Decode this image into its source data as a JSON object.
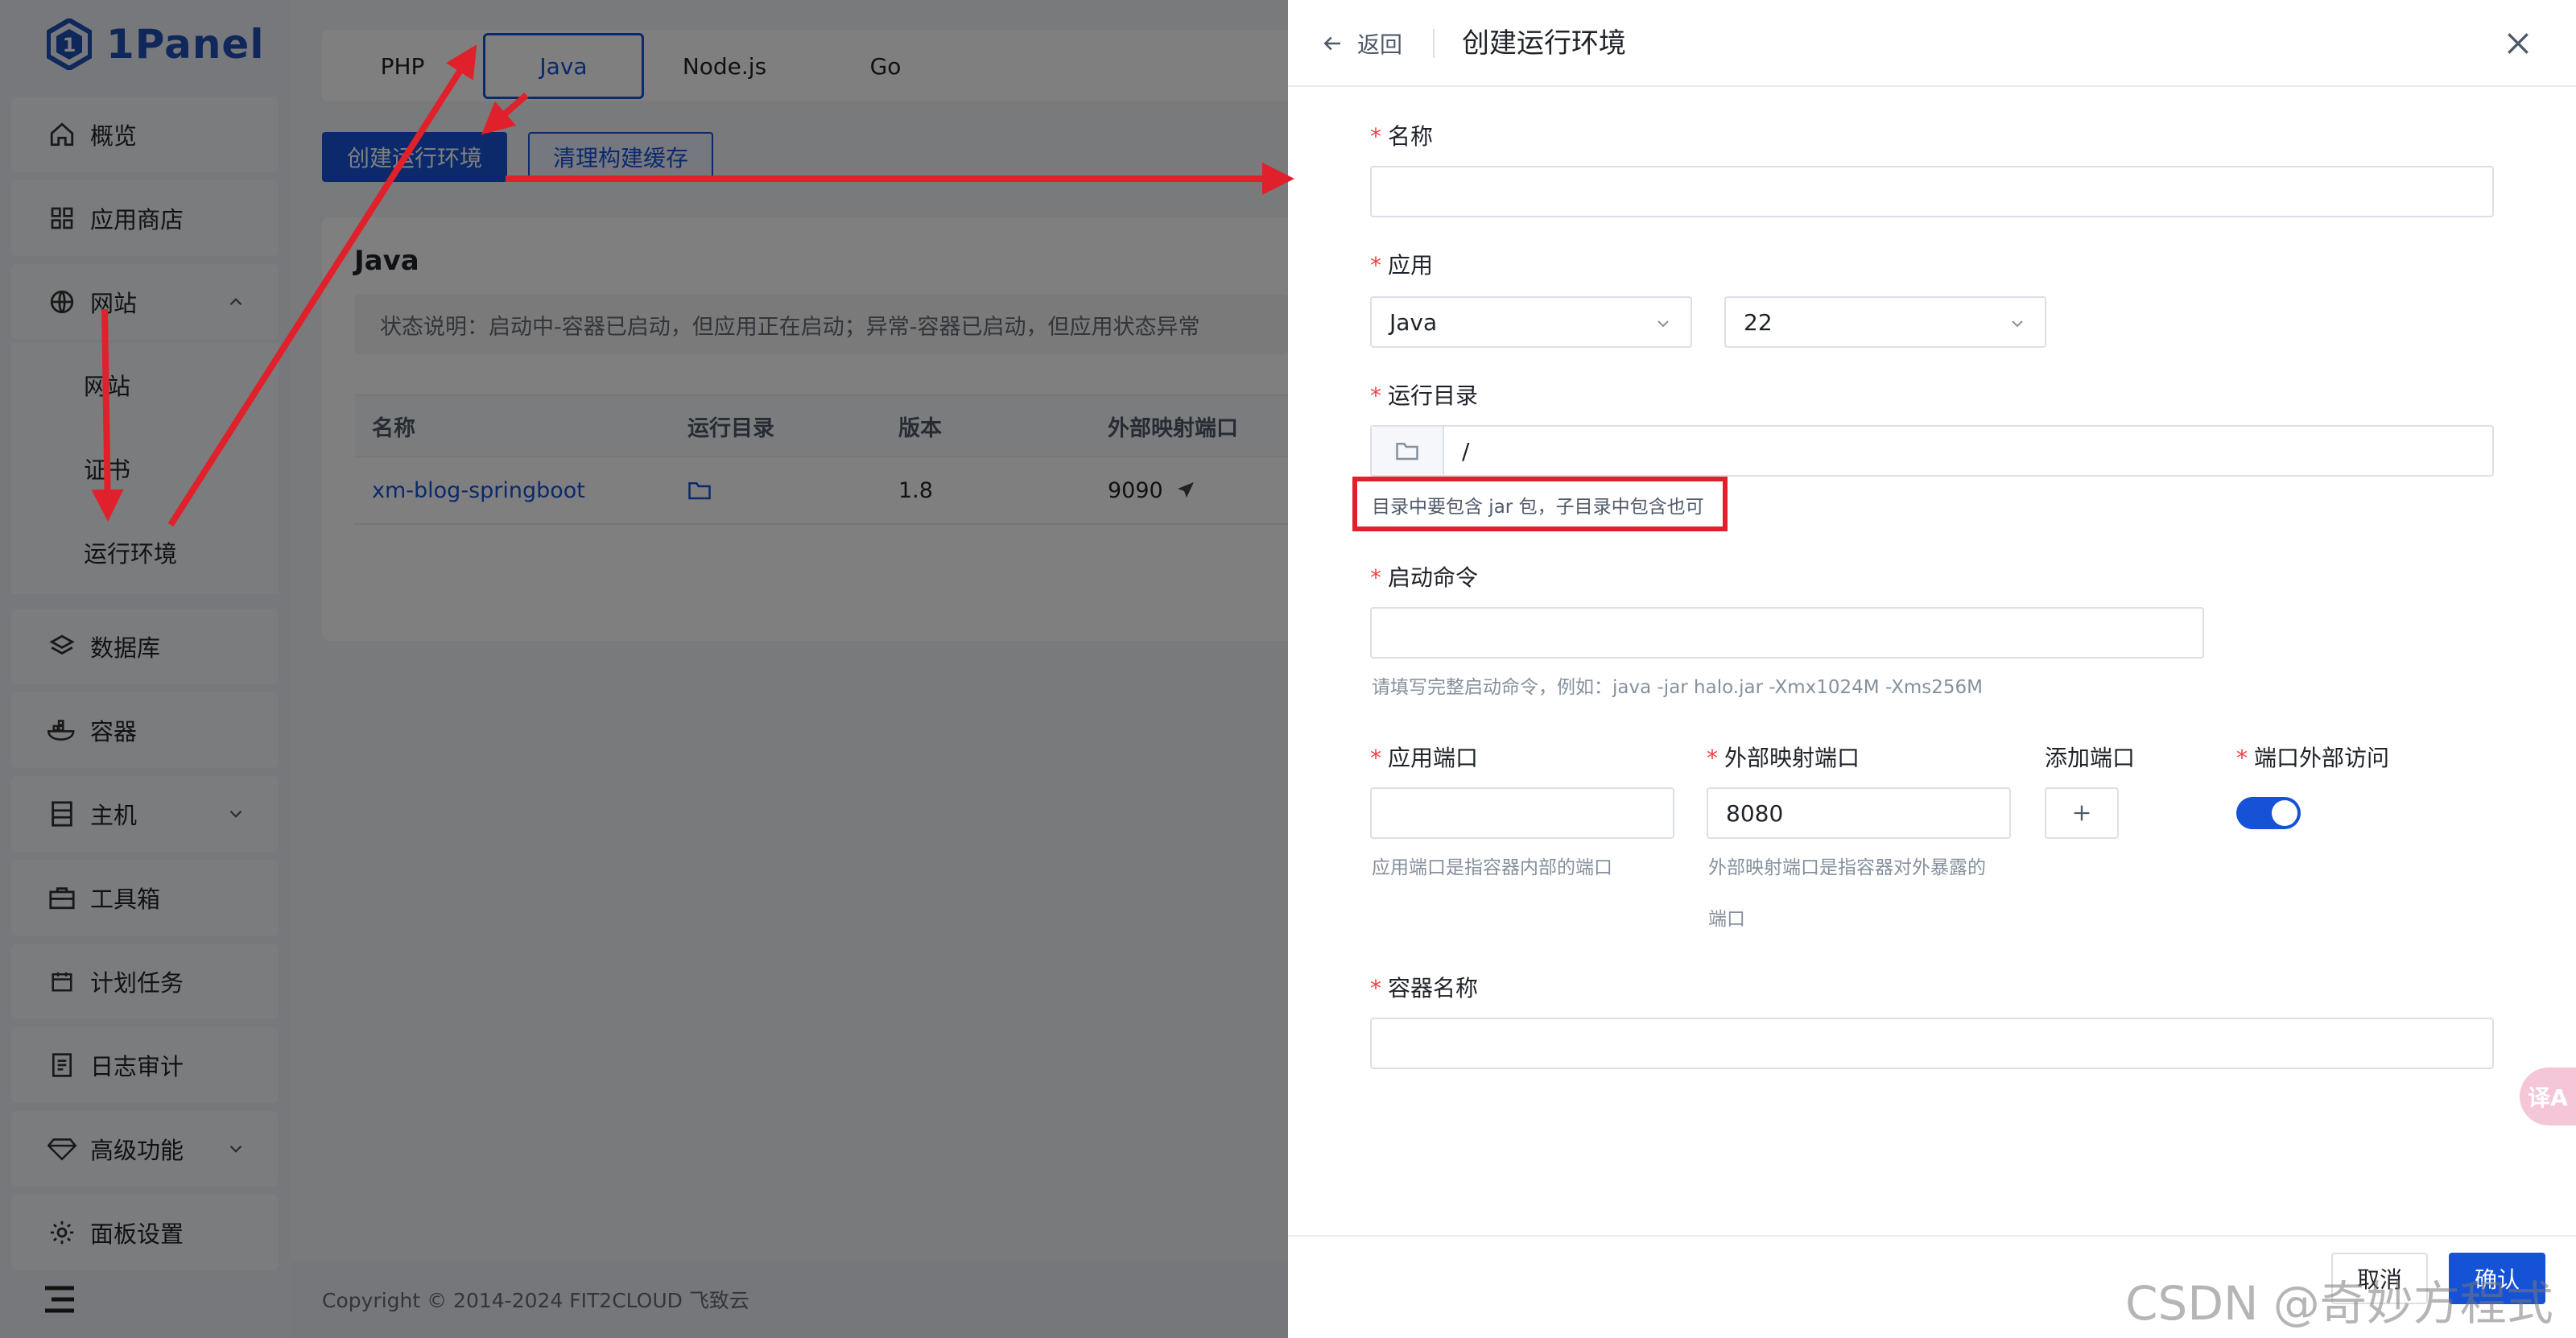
{
  "brand": {
    "name": "1Panel",
    "color": "#1e4fb5"
  },
  "sidebar": {
    "items": [
      {
        "label": "概览",
        "icon": "home-icon"
      },
      {
        "label": "应用商店",
        "icon": "grid-icon"
      },
      {
        "label": "网站",
        "icon": "globe-icon",
        "expanded": true
      },
      {
        "label": "网站",
        "sub": true
      },
      {
        "label": "证书",
        "sub": true
      },
      {
        "label": "运行环境",
        "sub": true
      },
      {
        "label": "数据库",
        "icon": "layers-icon"
      },
      {
        "label": "容器",
        "icon": "docker-icon"
      },
      {
        "label": "主机",
        "icon": "server-icon",
        "collapsible": true
      },
      {
        "label": "工具箱",
        "icon": "toolbox-icon"
      },
      {
        "label": "计划任务",
        "icon": "calendar-icon"
      },
      {
        "label": "日志审计",
        "icon": "log-icon"
      },
      {
        "label": "高级功能",
        "icon": "diamond-icon",
        "collapsible": true
      },
      {
        "label": "面板设置",
        "icon": "gear-icon"
      }
    ]
  },
  "main": {
    "tabs": [
      "PHP",
      "Java",
      "Node.js",
      "Go"
    ],
    "active_tab": "Java",
    "create_button": "创建运行环境",
    "clear_button": "清理构建缓存",
    "card_title": "Java",
    "notice": "状态说明：启动中-容器已启动，但应用正在启动；异常-容器已启动，但应用状态异常",
    "table": {
      "headers": [
        "名称",
        "运行目录",
        "版本",
        "外部映射端口"
      ],
      "rows": [
        {
          "name": "xm-blog-springboot",
          "version": "1.8",
          "port": "9090"
        }
      ]
    },
    "footer": "Copyright © 2014-2024 FIT2CLOUD 飞致云"
  },
  "drawer": {
    "back_label": "返回",
    "title": "创建运行环境",
    "fields": {
      "name_label": "名称",
      "app_label": "应用",
      "app_value": "Java",
      "version_value": "22",
      "dir_label": "运行目录",
      "dir_value": "/",
      "dir_help": "目录中要包含 jar 包，子目录中包含也可",
      "cmd_label": "启动命令",
      "cmd_help": "请填写完整启动命令，例如：java -jar halo.jar -Xmx1024M -Xms256M",
      "app_port_label": "应用端口",
      "app_port_help": "应用端口是指容器内部的端口",
      "ext_port_label": "外部映射端口",
      "ext_port_value": "8080",
      "ext_port_help_1": "外部映射端口是指容器对外暴露的",
      "ext_port_help_2": "端口",
      "add_port_label": "添加端口",
      "external_access_label": "端口外部访问",
      "external_access_on": true,
      "container_label": "容器名称"
    },
    "cancel_button": "取消",
    "confirm_button": "确认"
  },
  "fab": {
    "label": "译A"
  },
  "watermark": "CSDN @奇妙方程式",
  "colors": {
    "primary": "#1652d6",
    "annotation": "#e0212b",
    "required": "#f53f3f"
  }
}
